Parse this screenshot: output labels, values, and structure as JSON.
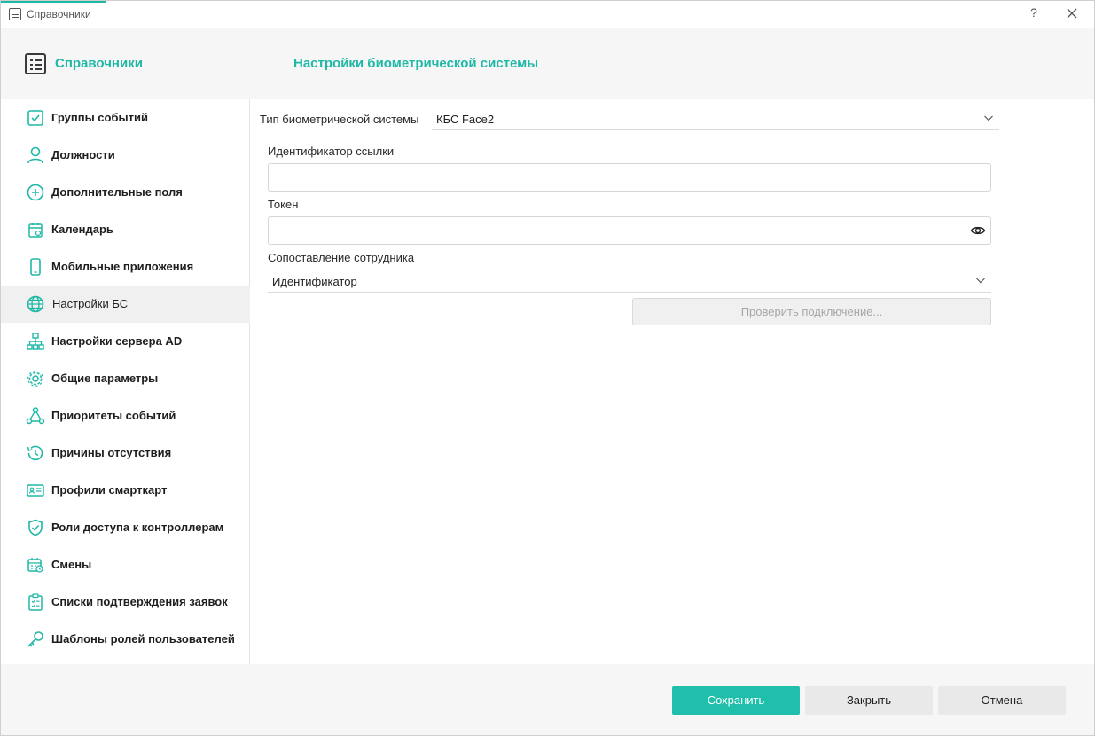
{
  "window": {
    "title": "Справочники",
    "help_label": "?",
    "accent_color": "#1fb8a7"
  },
  "header": {
    "section_title": "Справочники",
    "page_title": "Настройки биометрической системы"
  },
  "sidebar": {
    "items": [
      {
        "label": "Группы событий",
        "icon": "checkbox-icon",
        "active": false
      },
      {
        "label": "Должности",
        "icon": "person-icon",
        "active": false
      },
      {
        "label": "Дополнительные поля",
        "icon": "plus-circle-icon",
        "active": false
      },
      {
        "label": "Календарь",
        "icon": "calendar-icon",
        "active": false
      },
      {
        "label": "Мобильные приложения",
        "icon": "phone-icon",
        "active": false
      },
      {
        "label": "Настройки БС",
        "icon": "globe-icon",
        "active": true
      },
      {
        "label": "Настройки сервера AD",
        "icon": "network-icon",
        "active": false
      },
      {
        "label": "Общие параметры",
        "icon": "gear-icon",
        "active": false
      },
      {
        "label": "Приоритеты событий",
        "icon": "nodes-icon",
        "active": false
      },
      {
        "label": "Причины отсутствия",
        "icon": "history-icon",
        "active": false
      },
      {
        "label": "Профили смарткарт",
        "icon": "id-card-icon",
        "active": false
      },
      {
        "label": "Роли доступа к контроллерам",
        "icon": "shield-icon",
        "active": false
      },
      {
        "label": "Смены",
        "icon": "calendar-clock-icon",
        "active": false
      },
      {
        "label": "Списки подтверждения заявок",
        "icon": "clipboard-icon",
        "active": false
      },
      {
        "label": "Шаблоны ролей пользователей",
        "icon": "key-icon",
        "active": false
      }
    ]
  },
  "form": {
    "biometric_type_label": "Тип биометрической системы",
    "biometric_type_value": "КБС Face2",
    "link_id_label": "Идентификатор ссылки",
    "link_id_value": "",
    "token_label": "Токен",
    "token_value": "",
    "employee_match_label": "Сопоставление сотрудника",
    "employee_match_value": "Идентификатор",
    "check_button_label": "Проверить подключение..."
  },
  "footer": {
    "save_label": "Сохранить",
    "close_label": "Закрыть",
    "cancel_label": "Отмена"
  }
}
